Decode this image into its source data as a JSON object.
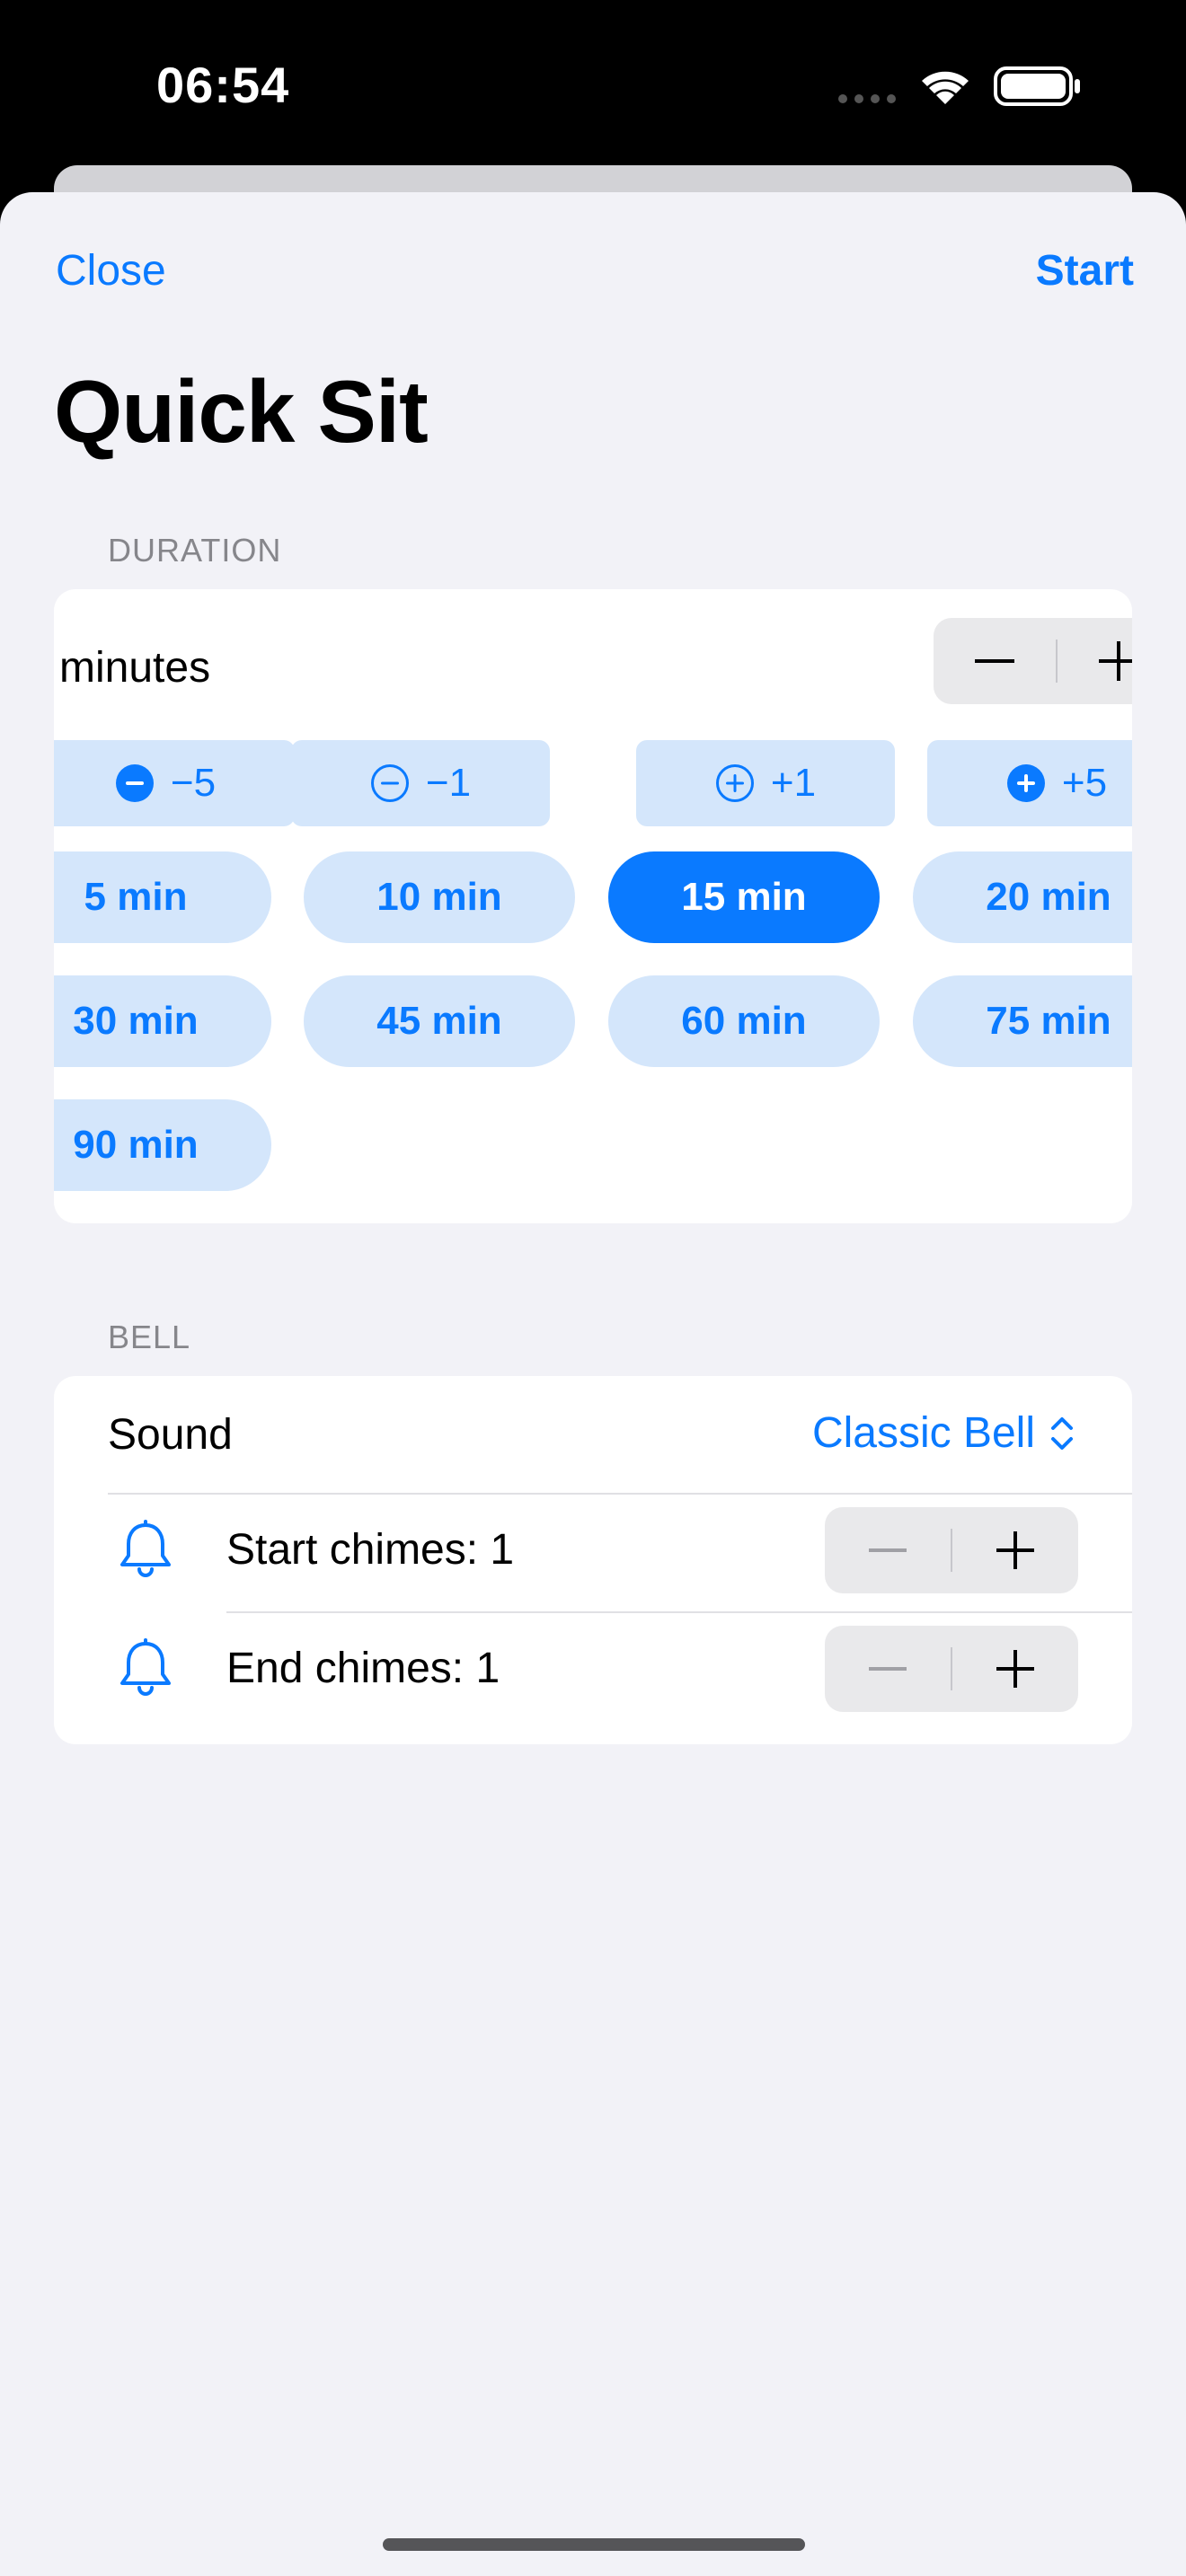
{
  "status_bar": {
    "time": "06:54"
  },
  "nav": {
    "close_label": "Close",
    "start_label": "Start"
  },
  "title": "Quick Sit",
  "duration": {
    "header": "DURATION",
    "minutes_label": "minutes",
    "adjust_buttons": [
      "−5",
      "−1",
      "+1",
      "+5"
    ],
    "presets": [
      "5 min",
      "10 min",
      "15 min",
      "20 min",
      "30 min",
      "45 min",
      "60 min",
      "75 min",
      "90 min"
    ],
    "selected_preset": "15 min"
  },
  "bell": {
    "header": "BELL",
    "sound_label": "Sound",
    "sound_value": "Classic Bell",
    "start_chimes_label": "Start chimes: 1",
    "end_chimes_label": "End chimes: 1"
  },
  "colors": {
    "accent": "#0a7aff",
    "chip_bg": "#d4e6fb",
    "background": "#f2f2f7"
  }
}
